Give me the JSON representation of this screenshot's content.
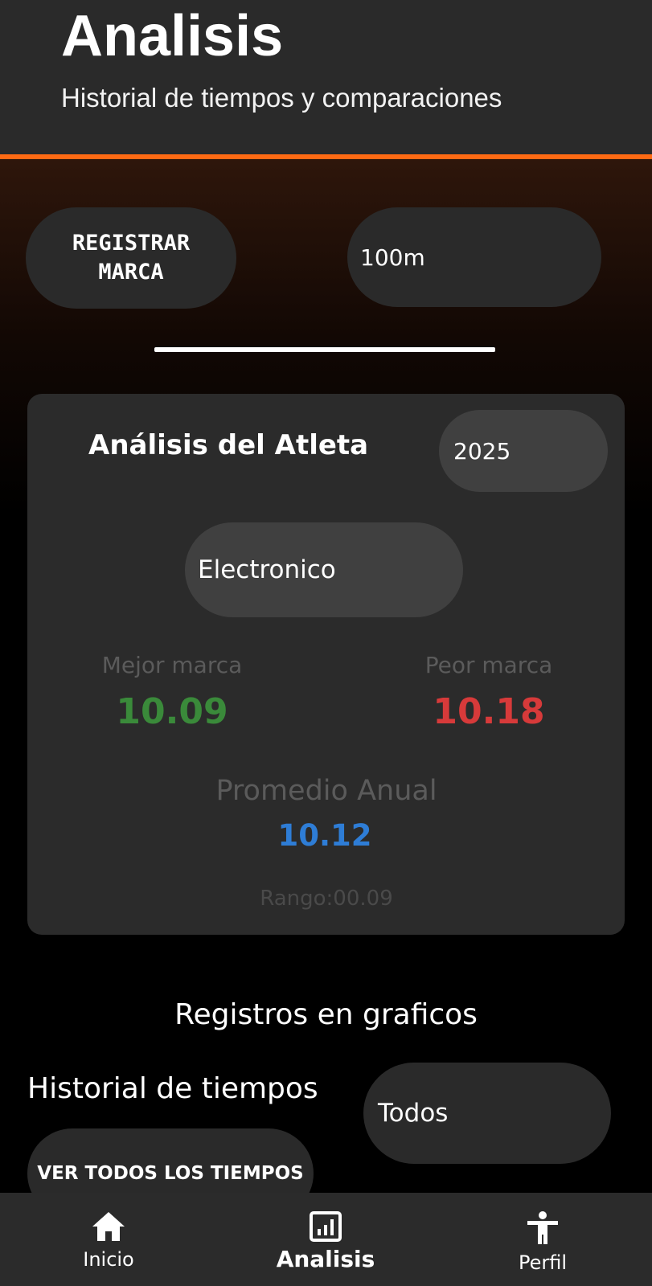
{
  "header": {
    "title": "Analisis",
    "subtitle": "Historial de tiempos y comparaciones"
  },
  "actions": {
    "register_label": "REGISTRAR\nMARCA",
    "event_selected": "100m"
  },
  "analysis_card": {
    "title": "Análisis del Atleta",
    "year_selected": "2025",
    "timing_selected": "Electronico",
    "best_label": "Mejor marca",
    "best_value": "10.09",
    "worst_label": "Peor marca",
    "worst_value": "10.18",
    "average_label": "Promedio Anual",
    "average_value": "10.12",
    "range_text": "Rango:00.09"
  },
  "charts_section": {
    "title": "Registros en graficos",
    "history_label": "Historial de tiempos",
    "filter_selected": "Todos",
    "see_all_label": "VER TODOS LOS TIEMPOS"
  },
  "bottom_nav": {
    "items": [
      {
        "label": "Inicio",
        "icon": "home-icon",
        "active": false
      },
      {
        "label": "Analisis",
        "icon": "bar-chart-icon",
        "active": true
      },
      {
        "label": "Perfil",
        "icon": "accessibility-icon",
        "active": false
      }
    ]
  },
  "colors": {
    "accent": "#ff6a13",
    "best": "#3a8a3a",
    "worst": "#d73a3a",
    "average": "#2e7dd6"
  }
}
